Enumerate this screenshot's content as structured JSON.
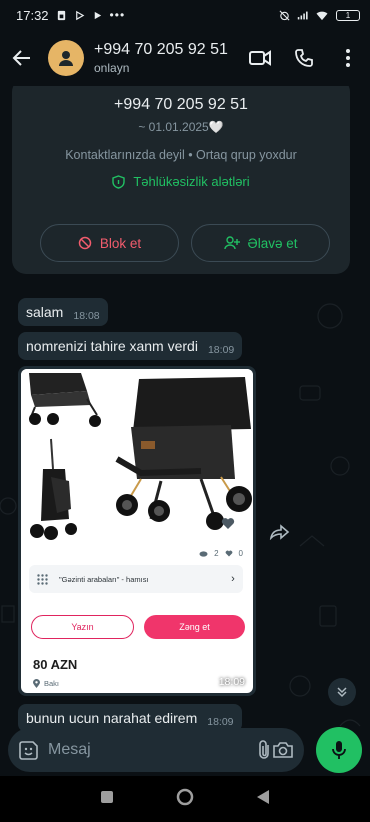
{
  "status_bar": {
    "time": "17:32",
    "battery": "1"
  },
  "header": {
    "title": "+994 70 205 92 51",
    "subtitle": "onlayn"
  },
  "info_card": {
    "phone": "+994 70 205 92 51",
    "date": "~ 01.01.2025🤍",
    "contacts_note": "Kontaktlarınızda deyil • Ortaq qrup yoxdur",
    "security_link": "Təhlükəsizlik alətləri",
    "block_label": "Blok et",
    "add_label": "Əlavə et"
  },
  "messages": [
    {
      "text": "salam",
      "time": "18:08"
    },
    {
      "text": "nomrenizi tahire xanm verdi",
      "time": "18:09"
    },
    {
      "text": "bunun ucun narahat edirem",
      "time": "18:09"
    }
  ],
  "media_message": {
    "time": "18:09",
    "ad": {
      "views": "2",
      "likes": "0",
      "category": "\"Gəzinti arabaları\" - hamısı",
      "write_label": "Yazın",
      "call_label": "Zəng et",
      "price": "80 AZN",
      "location": "Bakı"
    }
  },
  "input": {
    "placeholder": "Mesaj"
  },
  "colors": {
    "accent": "#21c063",
    "danger": "#f15c6d",
    "bubble": "#1f2c34",
    "background": "#0b1014"
  }
}
